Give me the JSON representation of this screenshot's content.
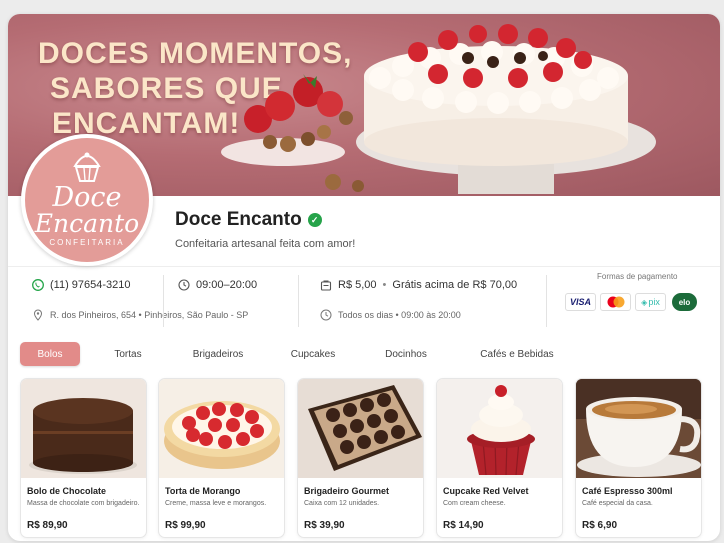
{
  "banner": {
    "headline": [
      "DOCES MOMENTOS,",
      "SABORES QUE",
      "ENCANTAM!"
    ]
  },
  "logo": {
    "line1": "Doce",
    "line2": "Encanto",
    "line3": "CONFEITARIA"
  },
  "store": {
    "name": "Doce Encanto",
    "tagline": "Confeitaria artesanal feita com amor!",
    "verified_icon": "check-circle-icon"
  },
  "info": {
    "phone": "(11) 97654-3210",
    "hours": "09:00–20:00",
    "address": "R. dos Pinheiros, 654 • Pinheiros, São Paulo - SP",
    "delivery_fee": "R$ 5,00",
    "free_delivery": "Grátis acima de R$ 70,00",
    "days": "Todos os dias • 09:00 às 20:00"
  },
  "payment": {
    "title": "Formas de pagamento",
    "methods": [
      "VISA",
      "mastercard",
      "pix",
      "elo"
    ]
  },
  "tabs": [
    "Bolos",
    "Tortas",
    "Brigadeiros",
    "Cupcakes",
    "Docinhos",
    "Cafés e Bebidas"
  ],
  "active_tab": "Bolos",
  "products": [
    {
      "name": "Bolo de Chocolate",
      "desc": "Massa de chocolate com brigadeiro.",
      "price": "R$ 89,90"
    },
    {
      "name": "Torta de Morango",
      "desc": "Creme, massa leve e morangos.",
      "price": "R$ 99,90"
    },
    {
      "name": "Brigadeiro Gourmet",
      "desc": "Caixa com 12 unidades.",
      "price": "R$ 39,90"
    },
    {
      "name": "Cupcake Red Velvet",
      "desc": "Com cream cheese.",
      "price": "R$ 14,90"
    },
    {
      "name": "Café Espresso 300ml",
      "desc": "Café especial da casa.",
      "price": "R$ 6,90"
    }
  ],
  "colors": {
    "accent": "#e28b89",
    "banner": "#b56c73",
    "verified": "#26a34a"
  }
}
